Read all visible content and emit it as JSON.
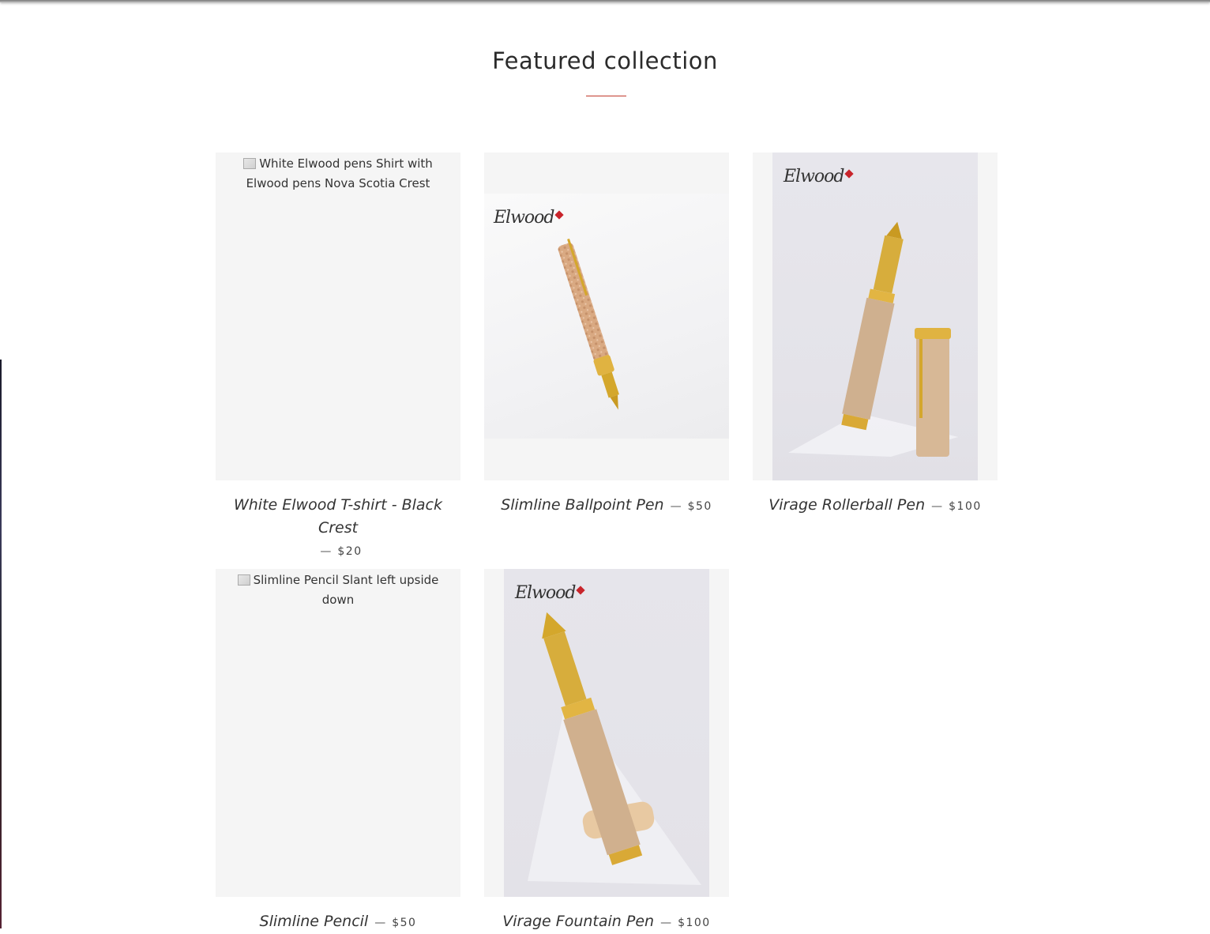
{
  "section": {
    "title": "Featured collection"
  },
  "products": [
    {
      "name": "White Elwood T-shirt - Black Crest",
      "separator": "—",
      "price": "$20",
      "image_alt": "White Elwood pens Shirt with Elwood pens Nova Scotia Crest"
    },
    {
      "name": "Slimline Ballpoint Pen",
      "separator": "—",
      "price": "$50",
      "logo": "Elwood"
    },
    {
      "name": "Virage Rollerball Pen",
      "separator": "—",
      "price": "$100",
      "logo": "Elwood"
    },
    {
      "name": "Slimline Pencil",
      "separator": "—",
      "price": "$50",
      "image_alt": "Slimline Pencil Slant left upside down"
    },
    {
      "name": "Virage Fountain Pen",
      "separator": "—",
      "price": "$100",
      "logo": "Elwood"
    }
  ],
  "colors": {
    "accent_rule": "#c0392b",
    "placeholder_bg": "#f5f5f5",
    "leaf": "#c8242b"
  }
}
